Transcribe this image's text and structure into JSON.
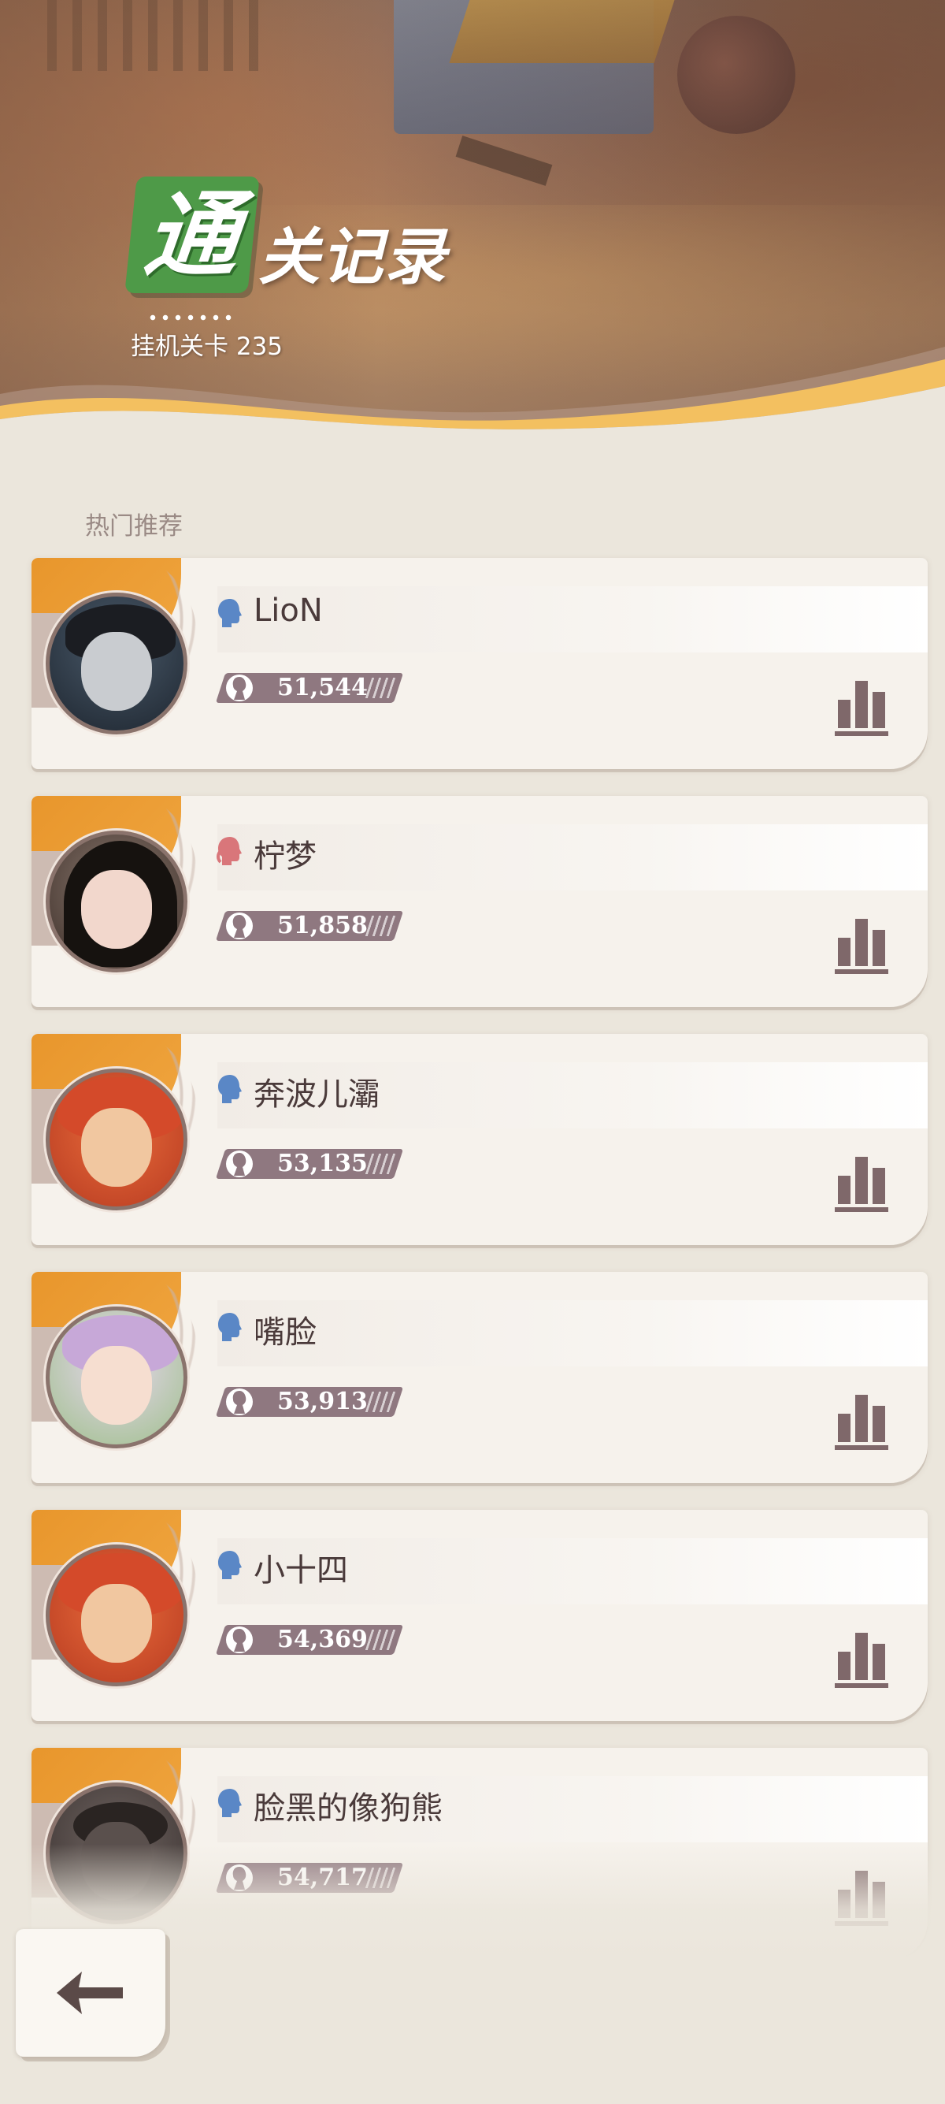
{
  "header": {
    "badge_char": "通",
    "title": "关记录",
    "subtitle": "挂机关卡 235"
  },
  "section": {
    "label": "热门推荐"
  },
  "records": [
    {
      "name": "LioN",
      "score": "51,544",
      "gender": "male",
      "avatar": "goth-character"
    },
    {
      "name": "柠梦",
      "score": "51,858",
      "gender": "female",
      "avatar": "photo-girl"
    },
    {
      "name": "奔波儿灞",
      "score": "53,135",
      "gender": "male",
      "avatar": "red-hair-character"
    },
    {
      "name": "嘴脸",
      "score": "53,913",
      "gender": "male",
      "avatar": "flower-character"
    },
    {
      "name": "小十四",
      "score": "54,369",
      "gender": "male",
      "avatar": "red-hair-character"
    },
    {
      "name": "脸黑的像狗熊",
      "score": "54,717",
      "gender": "male",
      "avatar": "dark-character"
    }
  ],
  "colors": {
    "badge_green": "#4e9a48",
    "male_icon": "#5a87c6",
    "female_icon": "#d9767a",
    "score_pill": "#8f7880",
    "accent_orange": "#e8962c",
    "card_bg": "#f6f2ec",
    "page_bg": "#ebe6dc"
  },
  "icons": {
    "back": "back-arrow-icon",
    "stats": "bar-chart-icon",
    "score": "character-silhouette-icon"
  }
}
